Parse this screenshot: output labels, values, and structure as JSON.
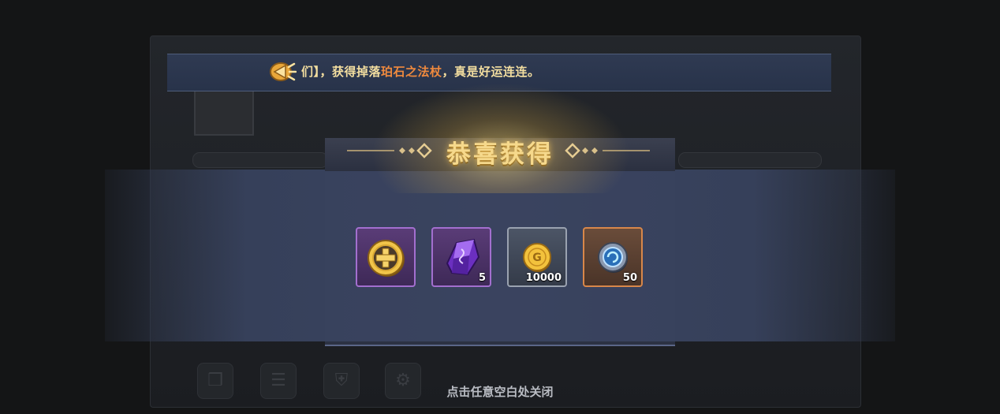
{
  "announcement": {
    "prefix": "们】，获得掉落",
    "item": "珀石之法杖",
    "suffix": "，真是好运连连。"
  },
  "reward_dialog": {
    "title": "恭喜获得",
    "items": [
      {
        "icon": "gold-cross-token-icon",
        "count": ""
      },
      {
        "icon": "purple-crystal-icon",
        "count": "5"
      },
      {
        "icon": "gold-coin-icon",
        "count": "10000"
      },
      {
        "icon": "blue-orb-coin-icon",
        "count": "50"
      }
    ],
    "close_hint": "点击任意空白处关闭"
  },
  "colors": {
    "title": "#f6d98c",
    "highlight": "#f08a3e",
    "panel": "#3a4460"
  }
}
